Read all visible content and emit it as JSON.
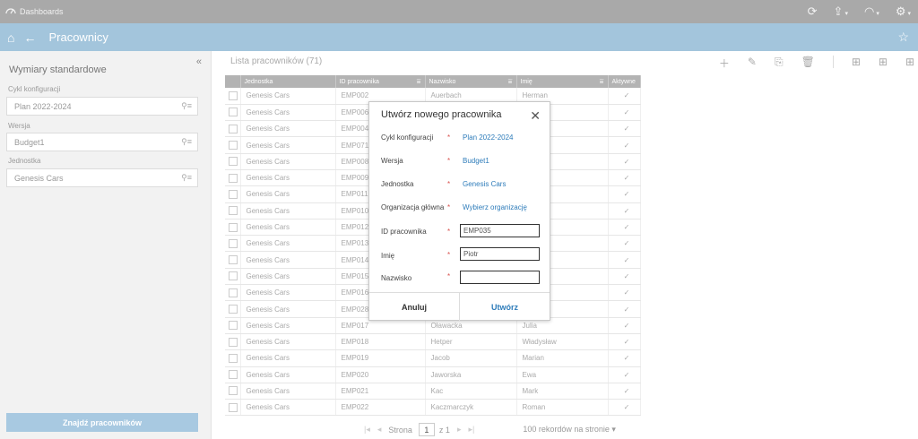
{
  "topbar": {
    "label": "Dashboards"
  },
  "titlebar": {
    "title": "Pracownicy"
  },
  "left": {
    "title": "Wymiary standardowe",
    "fields": [
      {
        "label": "Cykl konfiguracji",
        "value": "Plan 2022-2024"
      },
      {
        "label": "Wersja",
        "value": "Budget1"
      },
      {
        "label": "Jednostka",
        "value": "Genesis Cars"
      }
    ],
    "find_button": "Znajdź pracowników"
  },
  "list": {
    "title": "Lista pracowników (71)",
    "columns": [
      "Jednostka",
      "ID pracownika",
      "Nazwisko",
      "Imię",
      "Aktywne"
    ],
    "rows": [
      [
        "Genesis Cars",
        "EMP002",
        "Auerbach",
        "Herman"
      ],
      [
        "Genesis Cars",
        "EMP006",
        "",
        ""
      ],
      [
        "Genesis Cars",
        "EMP004",
        "",
        ""
      ],
      [
        "Genesis Cars",
        "EMP071",
        "",
        ""
      ],
      [
        "Genesis Cars",
        "EMP008",
        "",
        ""
      ],
      [
        "Genesis Cars",
        "EMP009",
        "",
        ""
      ],
      [
        "Genesis Cars",
        "EMP011",
        "",
        ""
      ],
      [
        "Genesis Cars",
        "EMP010",
        "",
        ""
      ],
      [
        "Genesis Cars",
        "EMP012",
        "",
        ""
      ],
      [
        "Genesis Cars",
        "EMP013",
        "",
        ""
      ],
      [
        "Genesis Cars",
        "EMP014",
        "",
        ""
      ],
      [
        "Genesis Cars",
        "EMP015",
        "",
        ""
      ],
      [
        "Genesis Cars",
        "EMP016",
        "",
        ""
      ],
      [
        "Genesis Cars",
        "EMP028",
        "",
        ""
      ],
      [
        "Genesis Cars",
        "EMP017",
        "Oławacka",
        "Julia"
      ],
      [
        "Genesis Cars",
        "EMP018",
        "Hetper",
        "Władysław"
      ],
      [
        "Genesis Cars",
        "EMP019",
        "Jacob",
        "Marian"
      ],
      [
        "Genesis Cars",
        "EMP020",
        "Jaworska",
        "Ewa"
      ],
      [
        "Genesis Cars",
        "EMP021",
        "Kac",
        "Mark"
      ],
      [
        "Genesis Cars",
        "EMP022",
        "Kaczmarczyk",
        "Roman"
      ]
    ]
  },
  "pager": {
    "page_label": "Strona",
    "page": "1",
    "of_label": "z 1",
    "per_page": "100 rekordów na stronie"
  },
  "modal": {
    "title": "Utwórz nowego pracownika",
    "rows": [
      {
        "label": "Cykl konfiguracji",
        "value": "Plan 2022-2024"
      },
      {
        "label": "Wersja",
        "value": "Budget1"
      },
      {
        "label": "Jednostka",
        "value": "Genesis Cars"
      },
      {
        "label": "Organizacja główna",
        "value": "Wybierz organizację"
      },
      {
        "label": "ID pracownika",
        "value": "EMP035"
      },
      {
        "label": "Imię",
        "value": "Piotr"
      },
      {
        "label": "Nazwisko",
        "value": ""
      }
    ],
    "cancel": "Anuluj",
    "create": "Utwórz"
  },
  "colors": {
    "titlebar": "#a3c5dc",
    "topbar": "#a9a9a9",
    "accent": "#2e7cba",
    "required": "#d9534f"
  }
}
